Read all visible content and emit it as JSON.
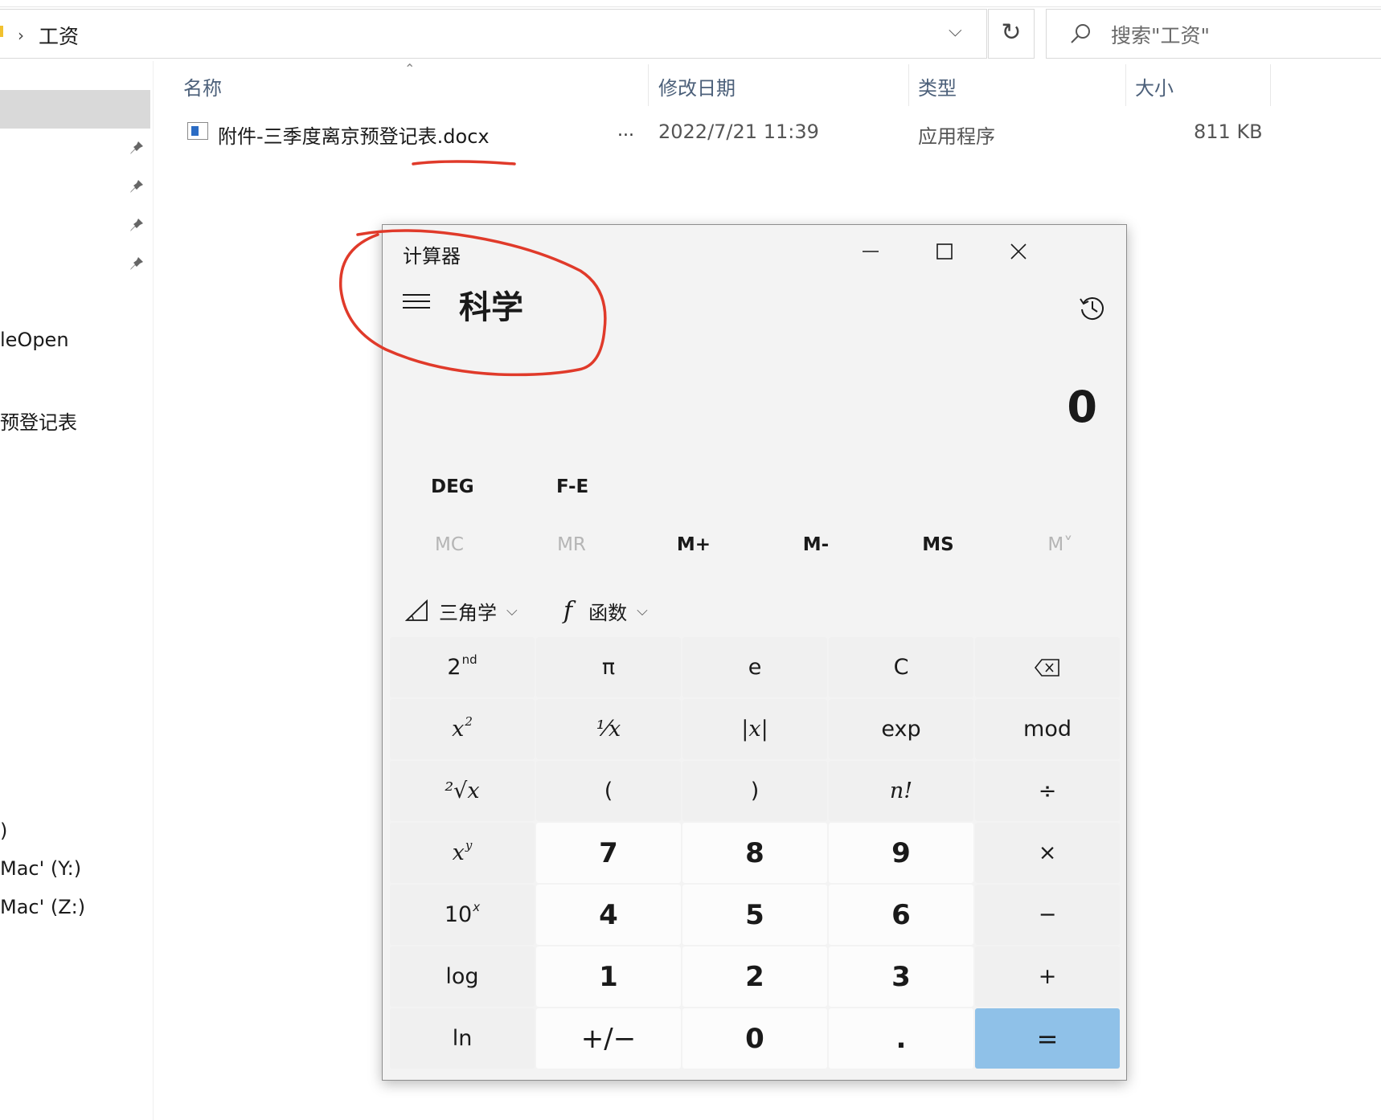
{
  "explorer": {
    "address": "工资",
    "search_placeholder": "搜索\"工资\"",
    "columns": {
      "name": "名称",
      "date": "修改日期",
      "type": "类型",
      "size": "大小"
    },
    "files": [
      {
        "name": "附件-三季度离京预登记表.docx",
        "ellipsis": "...",
        "date": "2022/7/21 11:39",
        "type": "应用程序",
        "size": "811 KB"
      }
    ],
    "nav": {
      "items": [
        "leOpen",
        "预登记表",
        ")",
        "Mac' (Y:)",
        "Mac' (Z:)"
      ]
    }
  },
  "calculator": {
    "title": "计算器",
    "mode": "科学",
    "display": "0",
    "options": {
      "deg": "DEG",
      "fe": "F-E"
    },
    "memory": {
      "mc": "MC",
      "mr": "MR",
      "mplus": "M+",
      "mminus": "M-",
      "ms": "MS",
      "mlist": "M˅"
    },
    "func_row": {
      "trig": "三角学",
      "func": "函数"
    },
    "keys": {
      "second": "2",
      "second_sup": "nd",
      "pi": "π",
      "e": "e",
      "clear": "C",
      "backspace": "⌫",
      "square": "x",
      "square_sup": "2",
      "reciprocal": "¹⁄x",
      "abs": "|x|",
      "exp": "exp",
      "mod": "mod",
      "sqrt": "²√x",
      "lparen": "(",
      "rparen": ")",
      "factorial": "n!",
      "divide": "÷",
      "power": "x",
      "power_sup": "y",
      "seven": "7",
      "eight": "8",
      "nine": "9",
      "multiply": "×",
      "ten_power": "10",
      "ten_power_sup": "x",
      "four": "4",
      "five": "5",
      "six": "6",
      "minus": "−",
      "log": "log",
      "one": "1",
      "two": "2",
      "three": "3",
      "plus": "+",
      "ln": "ln",
      "negate": "+/−",
      "zero": "0",
      "decimal": ".",
      "equals": "="
    }
  },
  "colors": {
    "annotation": "#e03a2a",
    "equals_key": "#8fc1e8",
    "header_text": "#4c607a"
  }
}
